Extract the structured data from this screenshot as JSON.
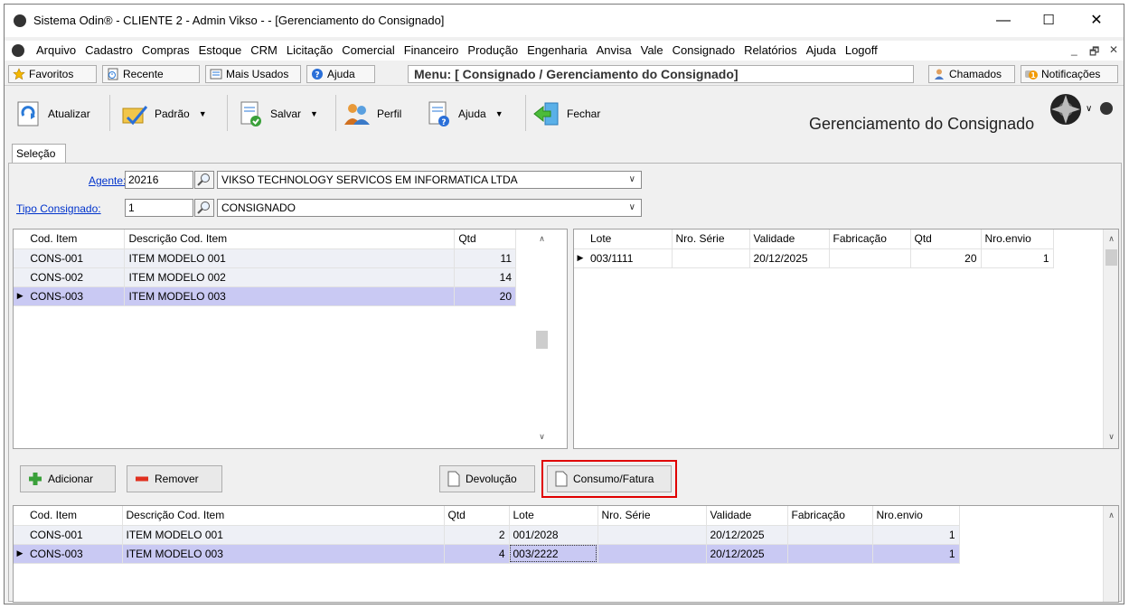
{
  "window": {
    "title": "Sistema Odin® - CLIENTE 2 - Admin Vikso -  - [Gerenciamento do Consignado]",
    "minimize": "—",
    "maximize": "☐",
    "close": "✕"
  },
  "menubar": {
    "items": [
      "Arquivo",
      "Cadastro",
      "Compras",
      "Estoque",
      "CRM",
      "Licitação",
      "Comercial",
      "Financeiro",
      "Produção",
      "Engenharia",
      "Anvisa",
      "Vale",
      "Consignado",
      "Relatórios",
      "Ajuda",
      "Logoff"
    ],
    "mdi_min": "_",
    "mdi_restore": "🗗",
    "mdi_close": "✕"
  },
  "quickbar": {
    "favoritos": "Favoritos",
    "recente": "Recente",
    "mais_usados": "Mais Usados",
    "ajuda": "Ajuda",
    "menu_path": "Menu: [ Consignado / Gerenciamento do Consignado]",
    "chamados": "Chamados",
    "notificacoes": "Notificações",
    "notif_count": "1"
  },
  "toolbar": {
    "atualizar": "Atualizar",
    "padrao": "Padrão",
    "salvar": "Salvar",
    "perfil": "Perfil",
    "ajuda": "Ajuda",
    "fechar": "Fechar",
    "page_title": "Gerenciamento do Consignado"
  },
  "tab": {
    "label": "Seleção"
  },
  "filters": {
    "agente_label": "Agente:",
    "agente_code": "20216",
    "agente_name": "VIKSO TECHNOLOGY SERVICOS EM INFORMATICA LTDA",
    "tipo_label": "Tipo Consignado:",
    "tipo_code": "1",
    "tipo_name": "CONSIGNADO"
  },
  "items_grid": {
    "headers": [
      "Cod. Item",
      "Descrição Cod. Item",
      "Qtd"
    ],
    "rows": [
      [
        "CONS-001",
        "ITEM MODELO 001",
        "11"
      ],
      [
        "CONS-002",
        "ITEM MODELO 002",
        "14"
      ],
      [
        "CONS-003",
        "ITEM MODELO 003",
        "20"
      ]
    ]
  },
  "lots_grid": {
    "headers": [
      "Lote",
      "Nro. Série",
      "Validade",
      "Fabricação",
      "Qtd",
      "Nro.envio"
    ],
    "rows": [
      [
        "003/1111",
        "",
        "20/12/2025",
        "",
        "20",
        "1"
      ]
    ]
  },
  "actions": {
    "adicionar": "Adicionar",
    "remover": "Remover",
    "devolucao": "Devolução",
    "consumo_fatura": "Consumo/Fatura"
  },
  "selected_grid": {
    "headers": [
      "Cod. Item",
      "Descrição Cod. Item",
      "Qtd",
      "Lote",
      "Nro. Série",
      "Validade",
      "Fabricação",
      "Nro.envio"
    ],
    "rows": [
      [
        "CONS-001",
        "ITEM MODELO 001",
        "2",
        "001/2028",
        "",
        "20/12/2025",
        "",
        "1"
      ],
      [
        "CONS-003",
        "ITEM MODELO 003",
        "4",
        "003/2222",
        "",
        "20/12/2025",
        "",
        "1"
      ]
    ]
  },
  "colors": {
    "selected_row": "#c9c9f3",
    "highlight": "#e00000",
    "link": "#0033cc"
  },
  "icons": {
    "favoritos": "star-icon",
    "recente": "clock-icon",
    "mais_usados": "list-icon",
    "ajuda": "help-icon",
    "chamados": "user-icon",
    "notificacoes": "bell-icon",
    "atualizar": "refresh-icon",
    "padrao": "check-folder-icon",
    "salvar": "save-icon",
    "perfil": "users-icon",
    "fechar": "exit-icon",
    "adicionar": "plus-icon",
    "remover": "minus-icon"
  }
}
